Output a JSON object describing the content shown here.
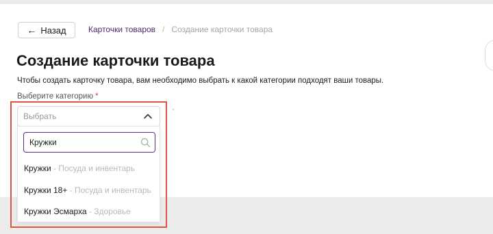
{
  "header": {
    "back_label": "Назад",
    "back_icon": "arrow-left-icon",
    "breadcrumb": {
      "link": "Карточки товаров",
      "separator": "/",
      "current": "Создание карточки товара"
    }
  },
  "main": {
    "title": "Создание карточки товара",
    "subtitle": "Чтобы создать карточку товара, вам необходимо выбрать к какой категории подходят ваши товары.",
    "field_label": "Выберите категорию",
    "required_mark": "*",
    "select": {
      "placeholder": "Выбрать",
      "icon": "chevron-up-icon"
    },
    "dropdown": {
      "search_value": "Кружки",
      "search_icon": "search-icon",
      "options": [
        {
          "name": "Кружки",
          "category": " - Посуда и инвентарь"
        },
        {
          "name": "Кружки 18+",
          "category": " - Посуда и инвентарь"
        },
        {
          "name": "Кружки Эсмарха",
          "category": " - Здоровье"
        }
      ]
    }
  },
  "colors": {
    "accent": "#5b2e8c",
    "link": "#4b2a6e",
    "highlight": "#e0533f",
    "required": "#e0392b"
  }
}
